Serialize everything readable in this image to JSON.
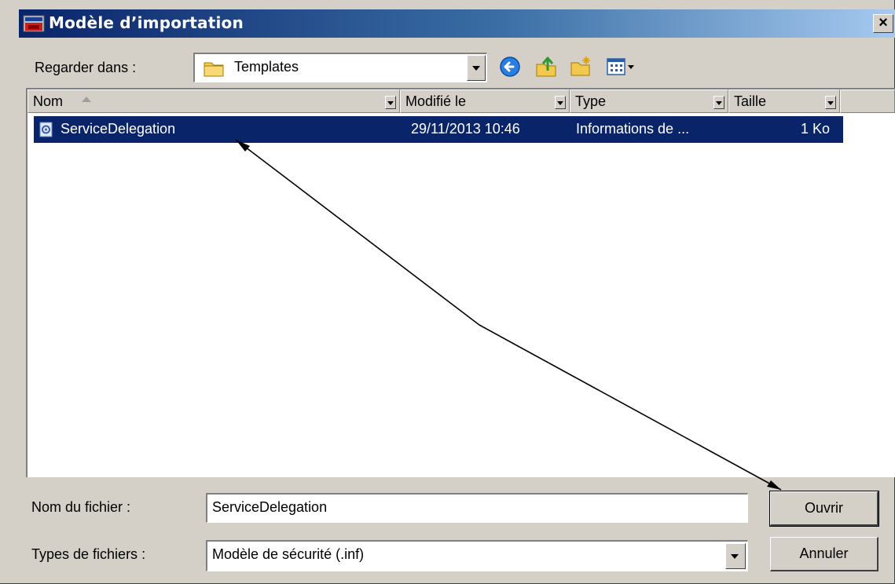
{
  "dialog": {
    "title": "Modèle d’importation",
    "close_label": "×"
  },
  "toolbar": {
    "look_in_label": "Regarder dans :",
    "look_in_value": "Templates",
    "icons": [
      "back-icon",
      "up-folder-icon",
      "new-folder-icon",
      "view-menu-icon"
    ]
  },
  "file_list": {
    "columns": [
      "Nom",
      "Modifié le",
      "Type",
      "Taille"
    ],
    "sorted_column": "Nom",
    "rows": [
      {
        "name": "ServiceDelegation",
        "modified": "29/11/2013 10:46",
        "type": "Informations de ...",
        "size": "1 Ko",
        "selected": true,
        "icon": "inf-file-icon"
      }
    ]
  },
  "footer": {
    "filename_label": "Nom du fichier :",
    "filename_value": "ServiceDelegation",
    "filetype_label": "Types de fichiers :",
    "filetype_value": "Modèle de sécurité (.inf)",
    "open_label": "Ouvrir",
    "cancel_label": "Annuler"
  },
  "colors": {
    "titlebar_start": "#0a246a",
    "titlebar_end": "#a6caf0",
    "selection": "#0a246a",
    "face": "#d4d0c8"
  }
}
